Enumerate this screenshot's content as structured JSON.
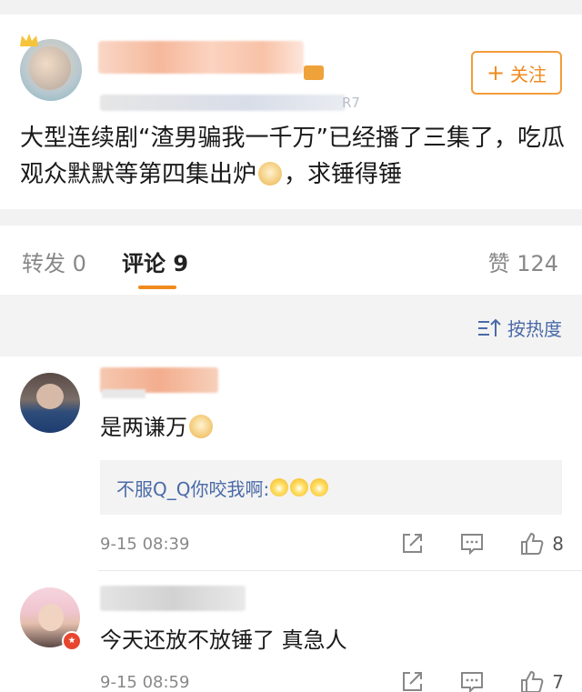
{
  "post": {
    "follow_label": "关注",
    "meta_tail": "R7",
    "text_part1": "大型连续剧“渣男骗我一千万”已经播了三集了，吃瓜观众默默等第四集出炉",
    "text_part2": "，求锤得锤"
  },
  "tabs": {
    "repost": "转发 0",
    "comment": "评论 9",
    "like": "赞 124"
  },
  "sort": {
    "label": "按热度"
  },
  "comments": [
    {
      "text": "是两谦万",
      "reply": "不服Q_Q你咬我啊:",
      "time": "9-15 08:39",
      "likes": "8"
    },
    {
      "text": "今天还放不放锤了 真急人",
      "time": "9-15 08:59",
      "likes": "7"
    }
  ],
  "colors": {
    "accent": "#f08a1c",
    "link": "#4a6aa8"
  },
  "icons": [
    "crown-icon",
    "plus-icon",
    "sort-icon",
    "share-icon",
    "comment-icon",
    "like-icon",
    "verified-badge-icon",
    "doge-emoji",
    "laugh-emoji"
  ]
}
